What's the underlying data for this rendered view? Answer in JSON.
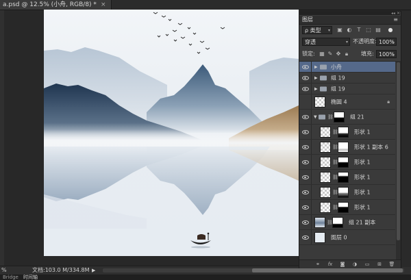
{
  "document_tab": {
    "title": "a.psd @ 12.5% (小舟, RGB/8) *",
    "close": "×"
  },
  "status_bar": {
    "zoom": "%",
    "doc_info": "文档:103.0 M/334.8M",
    "arrow": "▶"
  },
  "bottom_tabs": [
    "Bridge",
    "时间轴"
  ],
  "layers_panel": {
    "title": "图层",
    "menu_icon": "≡",
    "strip": "◂◂ ✕",
    "filter_label": "ρ 类型",
    "blend_mode": "穿透",
    "opacity_label": "不透明度:",
    "opacity_value": "100%",
    "lock_label": "锁定:",
    "fill_label": "填充:",
    "fill_value": "100%",
    "layers": [
      {
        "name": "小舟",
        "kind": "group",
        "selected": true
      },
      {
        "name": "组 19",
        "kind": "group"
      },
      {
        "name": "组 19",
        "kind": "group"
      },
      {
        "name": "椭圆 4",
        "kind": "shape",
        "locked": true
      },
      {
        "name": "组 21",
        "kind": "group-open"
      },
      {
        "name": "形状 1",
        "kind": "masked"
      },
      {
        "name": "形状 1 副本 6",
        "kind": "masked"
      },
      {
        "name": "形状 1",
        "kind": "masked"
      },
      {
        "name": "形状 1",
        "kind": "masked"
      },
      {
        "name": "形状 1",
        "kind": "masked"
      },
      {
        "name": "形状 1",
        "kind": "masked"
      },
      {
        "name": "组 21 副本",
        "kind": "masked"
      },
      {
        "name": "图层 0",
        "kind": "pixel"
      }
    ],
    "footer_icons": [
      "link-icon",
      "fx-icon",
      "mask-icon",
      "adjustment-icon",
      "new-group-icon",
      "new-layer-icon",
      "trash-icon"
    ]
  }
}
